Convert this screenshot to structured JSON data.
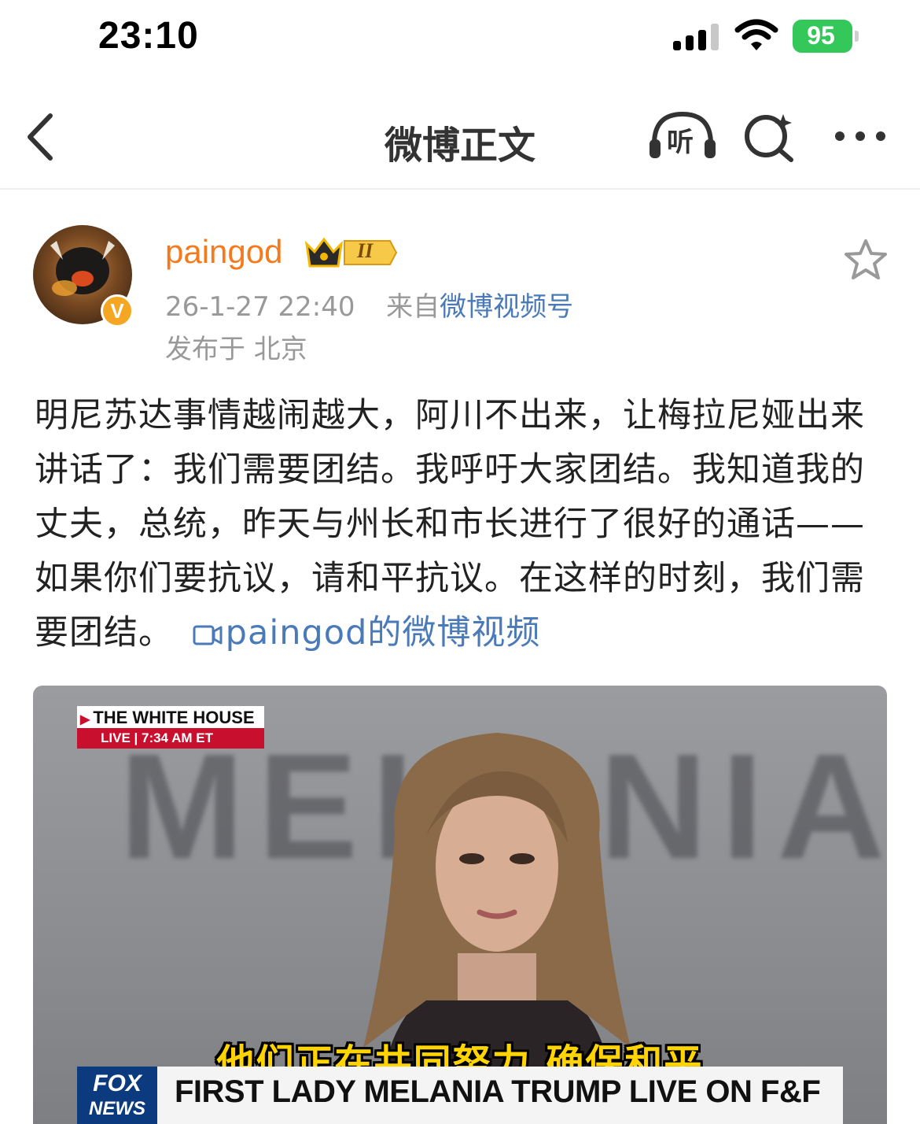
{
  "status_bar": {
    "time": "23:10",
    "battery": "95"
  },
  "nav": {
    "title": "微博正文",
    "listen_label": "听"
  },
  "post": {
    "username": "paingod",
    "level_badge": "II",
    "verified_badge": "V",
    "date": "26-1-27 22:40",
    "source_prefix": "来自",
    "source": "微博视频号",
    "location": "发布于 北京",
    "text": "明尼苏达事情越闹越大，阿川不出来，让梅拉尼娅出来讲话了：我们需要团结。我呼吁大家团结。我知道我的丈夫，总统，昨天与州长和市长进行了很好的通话——如果你们要抗议，请和平抗议。在这样的时刻，我们需要团结。",
    "video_link": "paingod的微博视频"
  },
  "video": {
    "background_word": "MELANIA",
    "badge_line1": "THE WHITE HOUSE",
    "badge_line2": "LIVE  |  7:34 AM ET",
    "subtitle": "他们正在共同努力 确保和平",
    "logo_line1": "FOX",
    "logo_line2": "NEWS",
    "headline": "FIRST LADY MELANIA TRUMP LIVE ON F&F"
  },
  "colors": {
    "username": "#f37b1d",
    "link": "#4a7ab8",
    "meta": "#999999",
    "battery": "#34c759",
    "fox_red": "#c8102e",
    "fox_blue": "#0b3a7e",
    "subtitle": "#ffd400"
  },
  "icons": [
    "signal-icon",
    "wifi-icon",
    "back-icon",
    "headphones-icon",
    "search-spark-icon",
    "more-icon",
    "star-icon",
    "video-camera-icon",
    "crown-icon"
  ]
}
